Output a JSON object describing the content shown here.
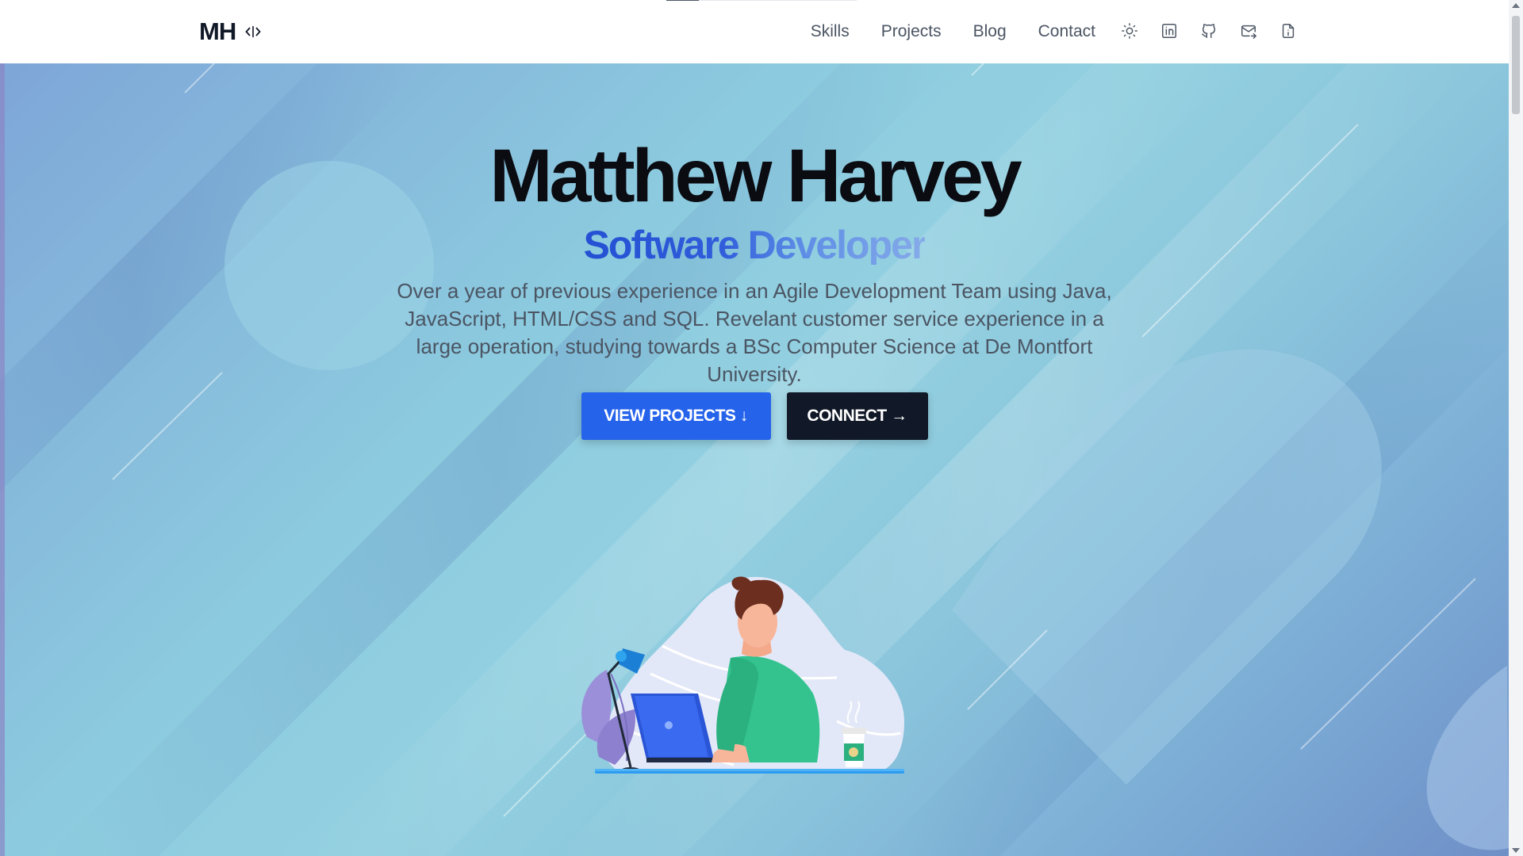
{
  "header": {
    "logo_text": "MH",
    "logo_icon": "code-icon",
    "nav": [
      "Skills",
      "Projects",
      "Blog",
      "Contact"
    ],
    "icons": [
      "sun-icon",
      "linkedin-icon",
      "github-icon",
      "mail-icon",
      "resume-icon"
    ],
    "scroll_progress": 0.17
  },
  "hero": {
    "name": "Matthew Harvey",
    "role": "Software Developer",
    "description": "Over a year of previous experience in an Agile Development Team using Java, JavaScript, HTML/CSS and SQL. Revelant customer service experience in a large operation, studying towards a BSc Computer Science at De Montfort University.",
    "primary_button": "VIEW PROJECTS ↓",
    "secondary_button": "CONNECT →"
  },
  "colors": {
    "primary": "#2563eb",
    "dark": "#111827",
    "text": "#4b5563",
    "accent_green": "#34c38f"
  }
}
